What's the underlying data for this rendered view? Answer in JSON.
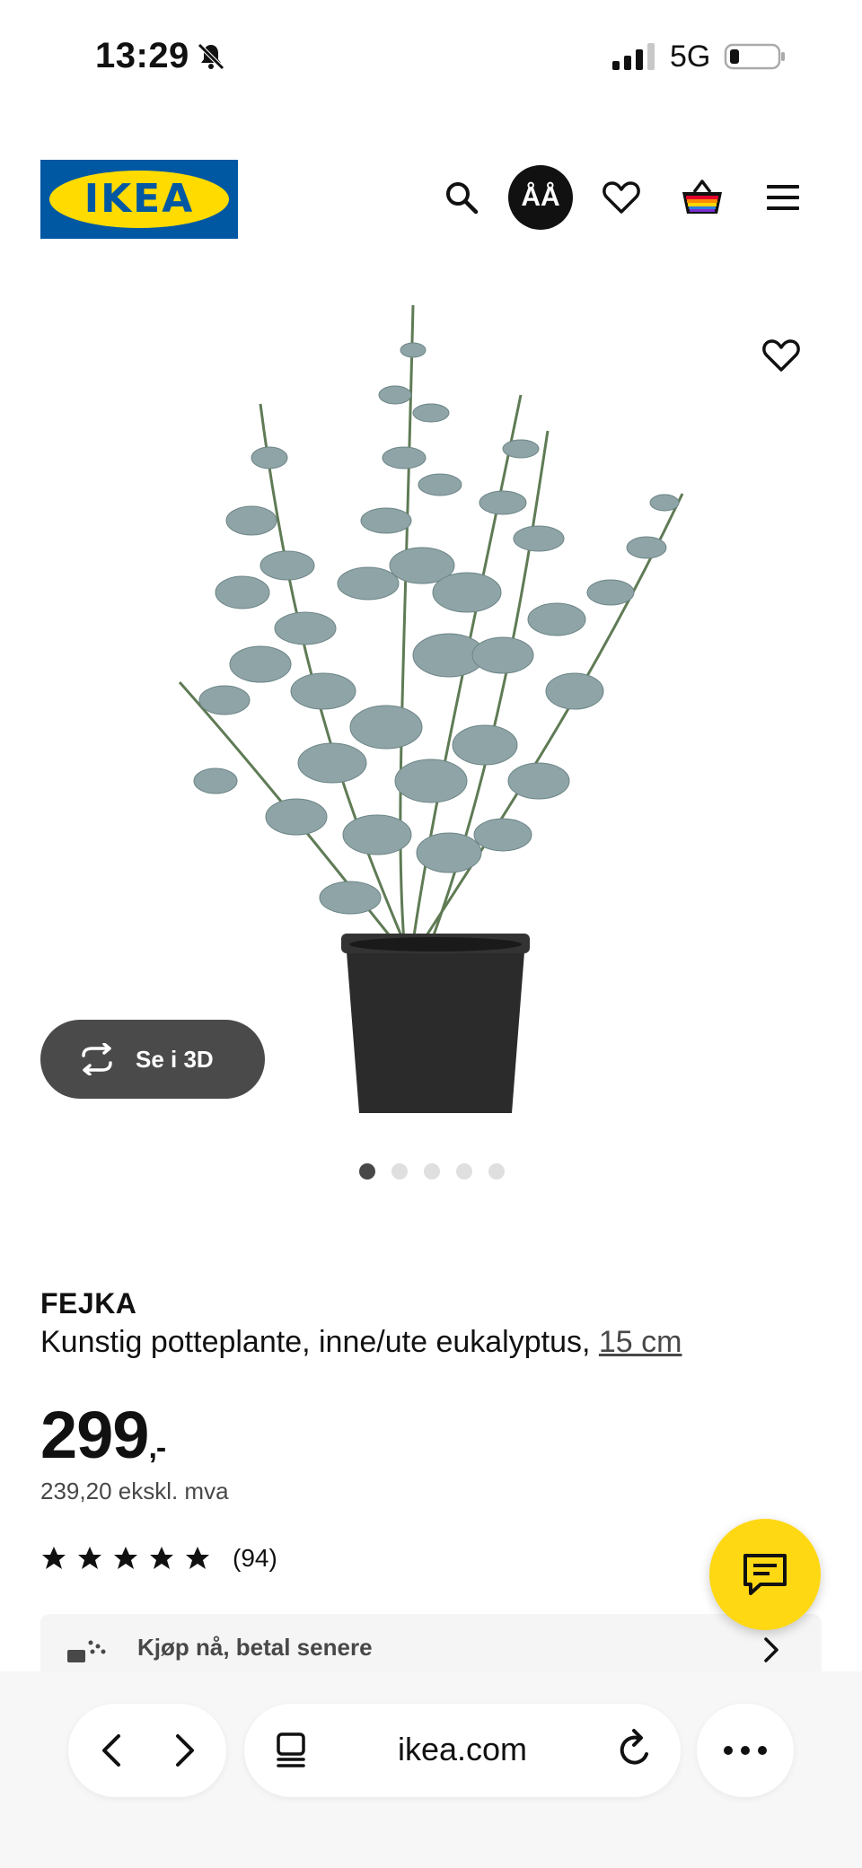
{
  "status_bar": {
    "time": "13:29",
    "network": "5G",
    "icons": [
      "bell-muted-icon",
      "signal-icon",
      "battery-icon"
    ]
  },
  "header": {
    "logo_text": "IKEA",
    "aa_label": "ÅÅ",
    "icons": [
      "search-icon",
      "font-size-icon",
      "heart-icon",
      "basket-icon",
      "hamburger-menu-icon"
    ]
  },
  "gallery": {
    "view_3d_label": "Se i 3D",
    "dots_total": 5,
    "active_dot": 1
  },
  "product": {
    "name": "FEJKA",
    "description": "Kunstig potteplante, inne/ute eukalyptus, ",
    "size": "15 cm",
    "price_main": "299",
    "price_suffix": ",-",
    "price_ex_vat": "239,20 ekskl. mva",
    "rating_stars": 5,
    "rating_count": "(94)"
  },
  "bnpl": {
    "label": "Kjøp nå, betal senere"
  },
  "browser": {
    "url": "ikea.com"
  },
  "colors": {
    "ikea_blue": "#0058a3",
    "ikea_yellow": "#ffdb00",
    "chat_yellow": "#ffd814",
    "dark": "#111111"
  }
}
